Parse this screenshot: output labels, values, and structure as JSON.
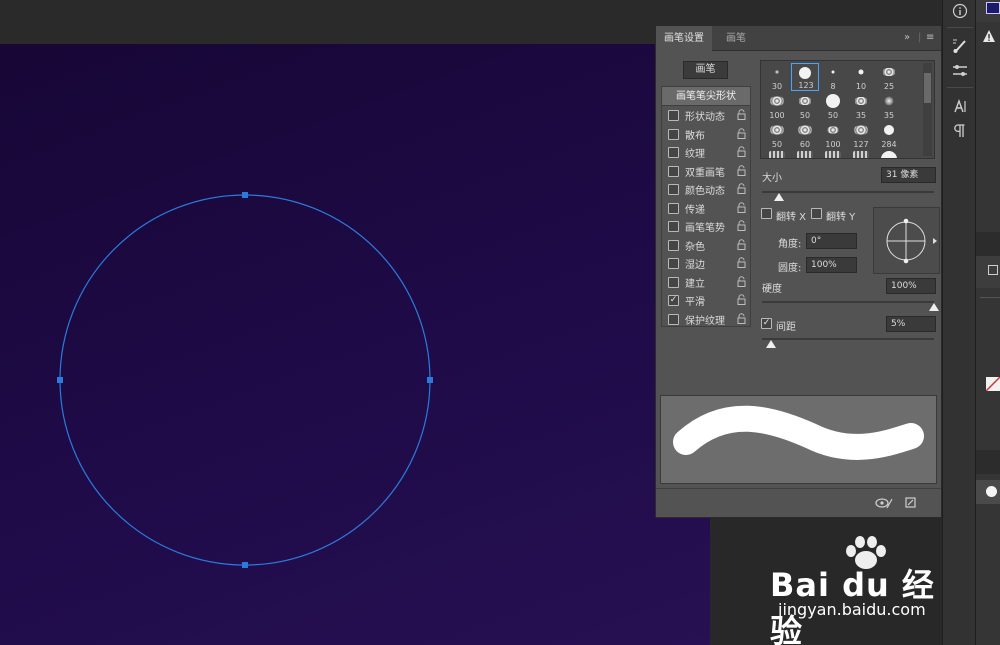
{
  "panel": {
    "tabs": [
      "画笔设置",
      "画笔"
    ],
    "brush_button": "画笔",
    "options_header": "画笔笔尖形状",
    "options": [
      {
        "label": "形状动态",
        "checked": false
      },
      {
        "label": "散布",
        "checked": false
      },
      {
        "label": "纹理",
        "checked": false
      },
      {
        "label": "双重画笔",
        "checked": false
      },
      {
        "label": "颜色动态",
        "checked": false
      },
      {
        "label": "传递",
        "checked": false
      },
      {
        "label": "画笔笔势",
        "checked": false
      },
      {
        "label": "杂色",
        "checked": false
      },
      {
        "label": "湿边",
        "checked": false
      },
      {
        "label": "建立",
        "checked": false
      },
      {
        "label": "平滑",
        "checked": true
      },
      {
        "label": "保护纹理",
        "checked": false
      }
    ],
    "presets": [
      "30",
      "123",
      "8",
      "10",
      "25",
      "100",
      "50",
      "50",
      "35",
      "35",
      "50",
      "60",
      "100",
      "127",
      "284"
    ],
    "size_label": "大小",
    "size_value": "31 像素",
    "flip_x_label": "翻转 X",
    "flip_y_label": "翻转 Y",
    "angle_label": "角度:",
    "angle_value": "0°",
    "roundness_label": "圆度:",
    "roundness_value": "100%",
    "hardness_label": "硬度",
    "hardness_value": "100%",
    "spacing_label": "间距",
    "spacing_value": "5%",
    "spacing_checked": true,
    "size_level": 0.1,
    "hardness_level": 1.0,
    "spacing_level": 0.05
  },
  "watermark": {
    "brand": "Bai du 经验",
    "url": "jingyan.baidu.com"
  },
  "colors": {
    "canvas_dark": "#170636",
    "path_blue": "#2a7bdc",
    "panel_bg": "#535353"
  }
}
